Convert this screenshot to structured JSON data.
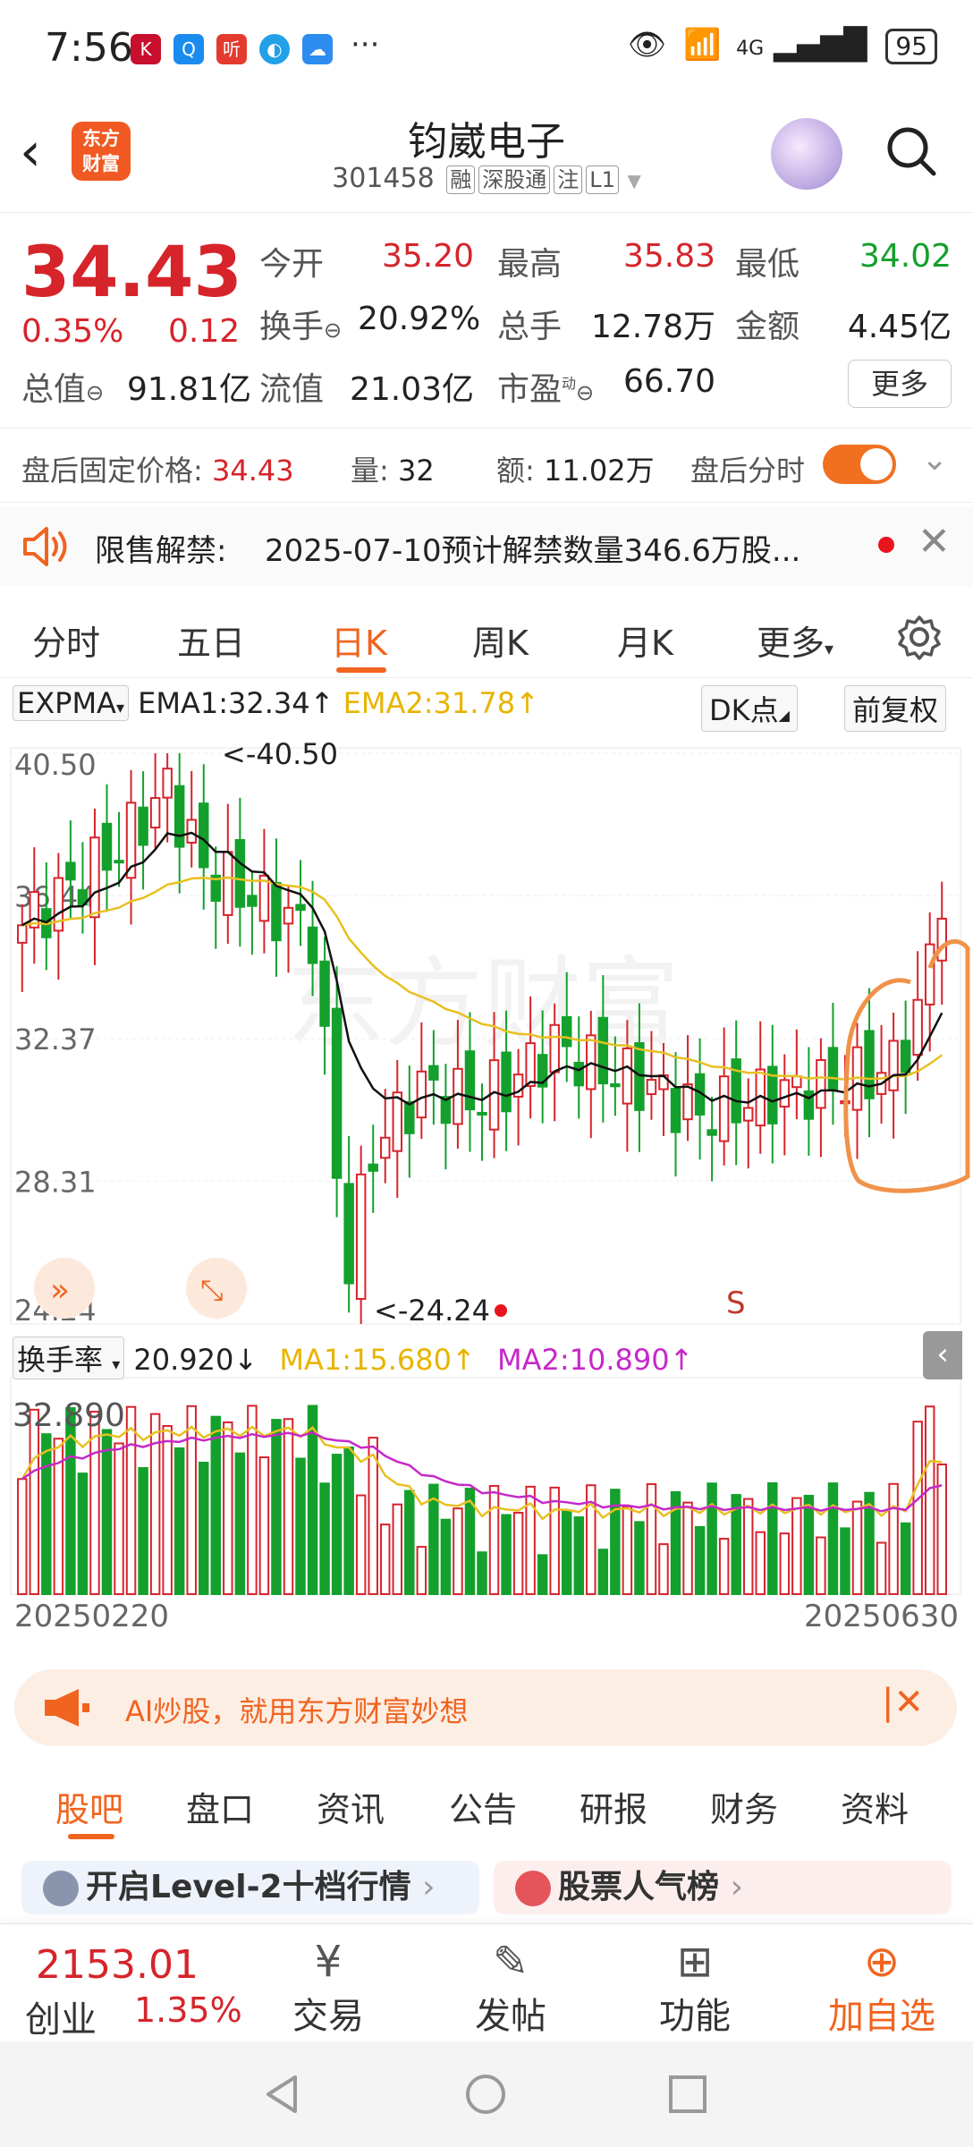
{
  "status_bar": {
    "time": "7:56",
    "network": "4G",
    "battery": "95"
  },
  "header": {
    "logo_text_line1": "东方",
    "logo_text_line2": "财富",
    "stock_name": "钧崴电子",
    "stock_code": "301458",
    "tags": [
      "融",
      "深股通",
      "注",
      "L1"
    ]
  },
  "quote": {
    "price": "34.43",
    "change_pct": "0.35%",
    "change_amt": "0.12",
    "open_label": "今开",
    "open_value": "35.20",
    "high_label": "最高",
    "high_value": "35.83",
    "low_label": "最低",
    "low_value": "34.02",
    "turnover_label": "换手",
    "turnover_value": "20.92%",
    "volume_label": "总手",
    "volume_value": "12.78万",
    "amount_label": "金额",
    "amount_value": "4.45亿",
    "mktcap_label": "总值",
    "mktcap_value": "91.81亿",
    "float_label": "流值",
    "float_value": "21.03亿",
    "pe_label": "市盈",
    "pe_sup": "动",
    "pe_value": "66.70",
    "more_label": "更多"
  },
  "after_hours": {
    "price_label": "盘后固定价格:",
    "price_value": "34.43",
    "vol_label": "量:",
    "vol_value": "32",
    "amt_label": "额:",
    "amt_value": "11.02万",
    "toggle_label": "盘后分时"
  },
  "announcement": {
    "title": "限售解禁:",
    "text": "2025-07-10预计解禁数量346.6万股..."
  },
  "tabs": [
    "分时",
    "五日",
    "日K",
    "周K",
    "月K",
    "更多"
  ],
  "kline": {
    "indicator": "EXPMA",
    "ema1": "EMA1:32.34↑",
    "ema2": "EMA2:31.78↑",
    "dk_label": "DK点",
    "adjust_label": "前复权",
    "max_label": "<-40.50",
    "min_label": "<-24.24",
    "s_marker": "S",
    "watermark": "东方财富"
  },
  "volume_panel": {
    "indicator": "换手率",
    "value": "20.920↓",
    "ma1": "MA1:15.680↑",
    "ma2": "MA2:10.890↑",
    "max_label": "32.890",
    "date_start": "20250220",
    "date_end": "20250630"
  },
  "chart_data": {
    "type": "candlestick",
    "y_ticks": [
      "40.50",
      "36.44",
      "32.37",
      "28.31",
      "24.24"
    ],
    "ylim": [
      24.24,
      40.5
    ],
    "x_range": [
      "20250220",
      "20250630"
    ],
    "series_labels": [
      "EMA1:32.34↑",
      "EMA2:31.78↑"
    ],
    "colors": {
      "up": "#d6242b",
      "down": "#14a02c",
      "ema1": "#111111",
      "ema2": "#e8c021",
      "ma1": "#e8c021",
      "ma2": "#c628c8"
    }
  },
  "ai_banner": {
    "text": "AI炒股，就用东方财富妙想"
  },
  "sub_tabs": [
    "股吧",
    "盘口",
    "资讯",
    "公告",
    "研报",
    "财务",
    "资料"
  ],
  "cards": {
    "left": "开启Level-2十档行情",
    "right": "股票人气榜"
  },
  "bottom_nav": {
    "index_value": "2153.01",
    "index_name": "创业",
    "index_change": "1.35%",
    "trade": "交易",
    "post": "发帖",
    "features": "功能",
    "add_watch": "加自选"
  }
}
